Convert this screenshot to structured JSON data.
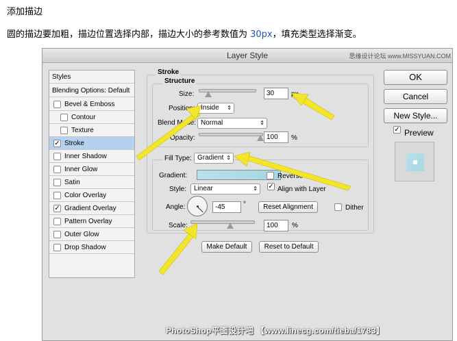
{
  "article": {
    "heading": "添加描边",
    "body_prefix": "圆的描边要加粗，描边位置选择内部，描边大小的参考数值为 ",
    "body_highlight": "30px",
    "body_suffix": "，填充类型选择渐变。"
  },
  "dialog": {
    "title": "Layer Style",
    "watermark_top": "思缘设计论坛 www.MISSYUAN.COM",
    "watermark_bottom": "PhotoShop平面设计吧 【www.linecg.com/tieba/1783】"
  },
  "styles_panel": {
    "header": "Styles",
    "blending": "Blending Options: Default",
    "items": [
      {
        "label": "Bevel & Emboss",
        "checked": false
      },
      {
        "label": "Contour",
        "checked": false
      },
      {
        "label": "Texture",
        "checked": false
      },
      {
        "label": "Stroke",
        "checked": true
      },
      {
        "label": "Inner Shadow",
        "checked": false
      },
      {
        "label": "Inner Glow",
        "checked": false
      },
      {
        "label": "Satin",
        "checked": false
      },
      {
        "label": "Color Overlay",
        "checked": false
      },
      {
        "label": "Gradient Overlay",
        "checked": true
      },
      {
        "label": "Pattern Overlay",
        "checked": false
      },
      {
        "label": "Outer Glow",
        "checked": false
      },
      {
        "label": "Drop Shadow",
        "checked": false
      }
    ]
  },
  "stroke": {
    "title": "Stroke",
    "structure_title": "Structure",
    "size_label": "Size:",
    "size_value": "30",
    "size_unit": "px",
    "position_label": "Position:",
    "position_value": "Inside",
    "blend_label": "Blend Mode:",
    "blend_value": "Normal",
    "opacity_label": "Opacity:",
    "opacity_value": "100",
    "opacity_unit": "%",
    "fill_label": "Fill Type:",
    "fill_value": "Gradient",
    "gradient_label": "Gradient:",
    "reverse_label": "Reverse",
    "style_label": "Style:",
    "style_value": "Linear",
    "align_label": "Align with Layer",
    "angle_label": "Angle:",
    "angle_value": "-45",
    "angle_unit": "°",
    "reset_alignment": "Reset Alignment",
    "dither_label": "Dither",
    "scale_label": "Scale:",
    "scale_value": "100",
    "scale_unit": "%",
    "make_default": "Make Default",
    "reset_default": "Reset to Default"
  },
  "buttons": {
    "ok": "OK",
    "cancel": "Cancel",
    "new_style": "New Style...",
    "preview": "Preview"
  },
  "colors": {
    "arrow": "#f3e62a",
    "gradient_start": "#b9e1e9",
    "gradient_end": "#a4d7e2",
    "selected_row": "#b4d1f0"
  }
}
